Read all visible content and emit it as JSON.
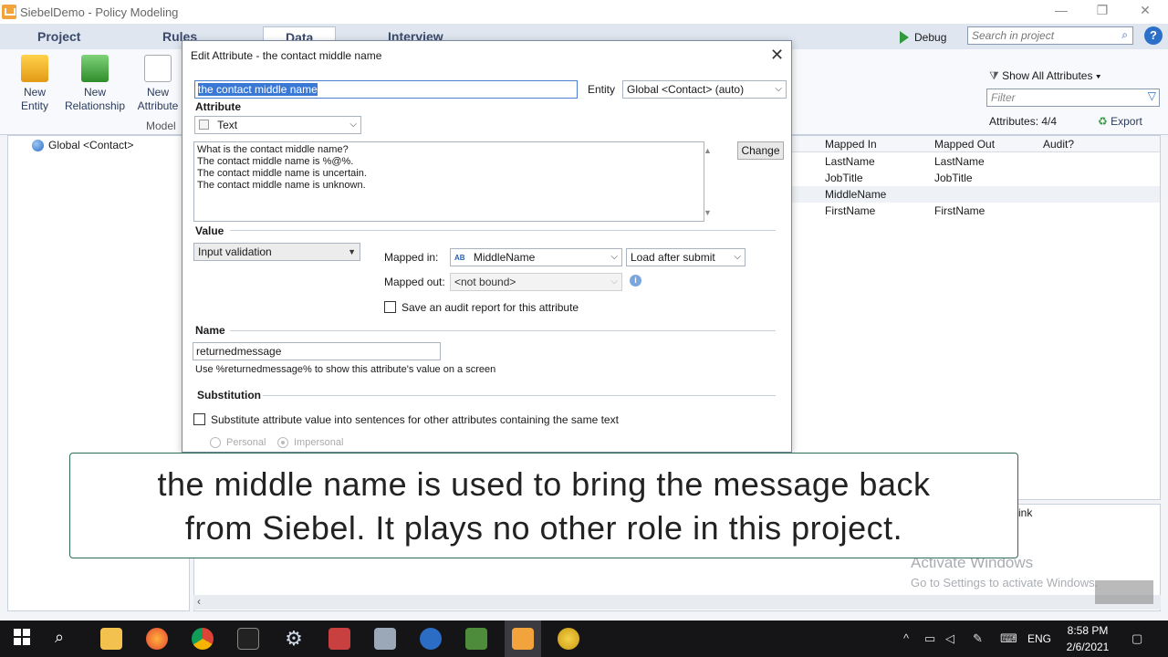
{
  "window": {
    "title": "SiebelDemo - Policy Modeling"
  },
  "ribbon": {
    "tabs": [
      "Project",
      "Rules",
      "Data",
      "Interview"
    ],
    "debug_label": "Debug",
    "search_placeholder": "Search in project",
    "new_entity": [
      "New",
      "Entity"
    ],
    "new_relationship": [
      "New",
      "Relationship"
    ],
    "new_attribute": [
      "New",
      "Attribute"
    ],
    "group_label": "Model",
    "show_all": "Show All Attributes ▾",
    "filter_placeholder": "Filter",
    "attr_count": "Attributes: 4/4",
    "export": "Export"
  },
  "tree": {
    "root": "Global <Contact>"
  },
  "grid": {
    "headers": [
      "Mapped In",
      "Mapped Out",
      "Audit?"
    ],
    "rows": [
      [
        "LastName",
        "LastName"
      ],
      [
        "JobTitle",
        "JobTitle"
      ],
      [
        "MiddleName",
        ""
      ],
      [
        "FirstName",
        "FirstName"
      ]
    ],
    "lower_header": "ink"
  },
  "dialog": {
    "title": "Edit Attribute - the contact middle name",
    "attribute_text": "the contact middle name",
    "entity_label": "Entity",
    "entity_value": "Global <Contact> (auto)",
    "attribute_heading": "Attribute",
    "attribute_type": "Text",
    "phrasings": [
      "What is the contact middle name?",
      "The contact middle name is %@%.",
      "The contact middle name is uncertain.",
      "The contact middle name is unknown."
    ],
    "change_button": "Change",
    "value_heading": "Value",
    "input_validation": "Input validation",
    "mapped_in_label": "Mapped in:",
    "mapped_in_value": "MiddleName",
    "load_option": "Load after submit",
    "mapped_out_label": "Mapped out:",
    "mapped_out_value": "<not bound>",
    "audit_label": "Save an audit report for this attribute",
    "name_heading": "Name",
    "name_value": "returnedmessage",
    "name_hint": "Use %returnedmessage% to show this attribute's value on a screen",
    "substitution_heading": "Substitution",
    "substitute_label": "Substitute attribute value into sentences for other attributes containing the same text",
    "radio_personal": "Personal",
    "radio_impersonal": "Impersonal"
  },
  "caption": {
    "line1": "the middle name is used to bring the message back",
    "line2": "from Siebel. It plays no other role in this project."
  },
  "watermark": {
    "line1": "Activate Windows",
    "line2": "Go to Settings to activate Windows."
  },
  "taskbar": {
    "lang": "ENG",
    "time": "8:58 PM",
    "date": "2/6/2021"
  }
}
